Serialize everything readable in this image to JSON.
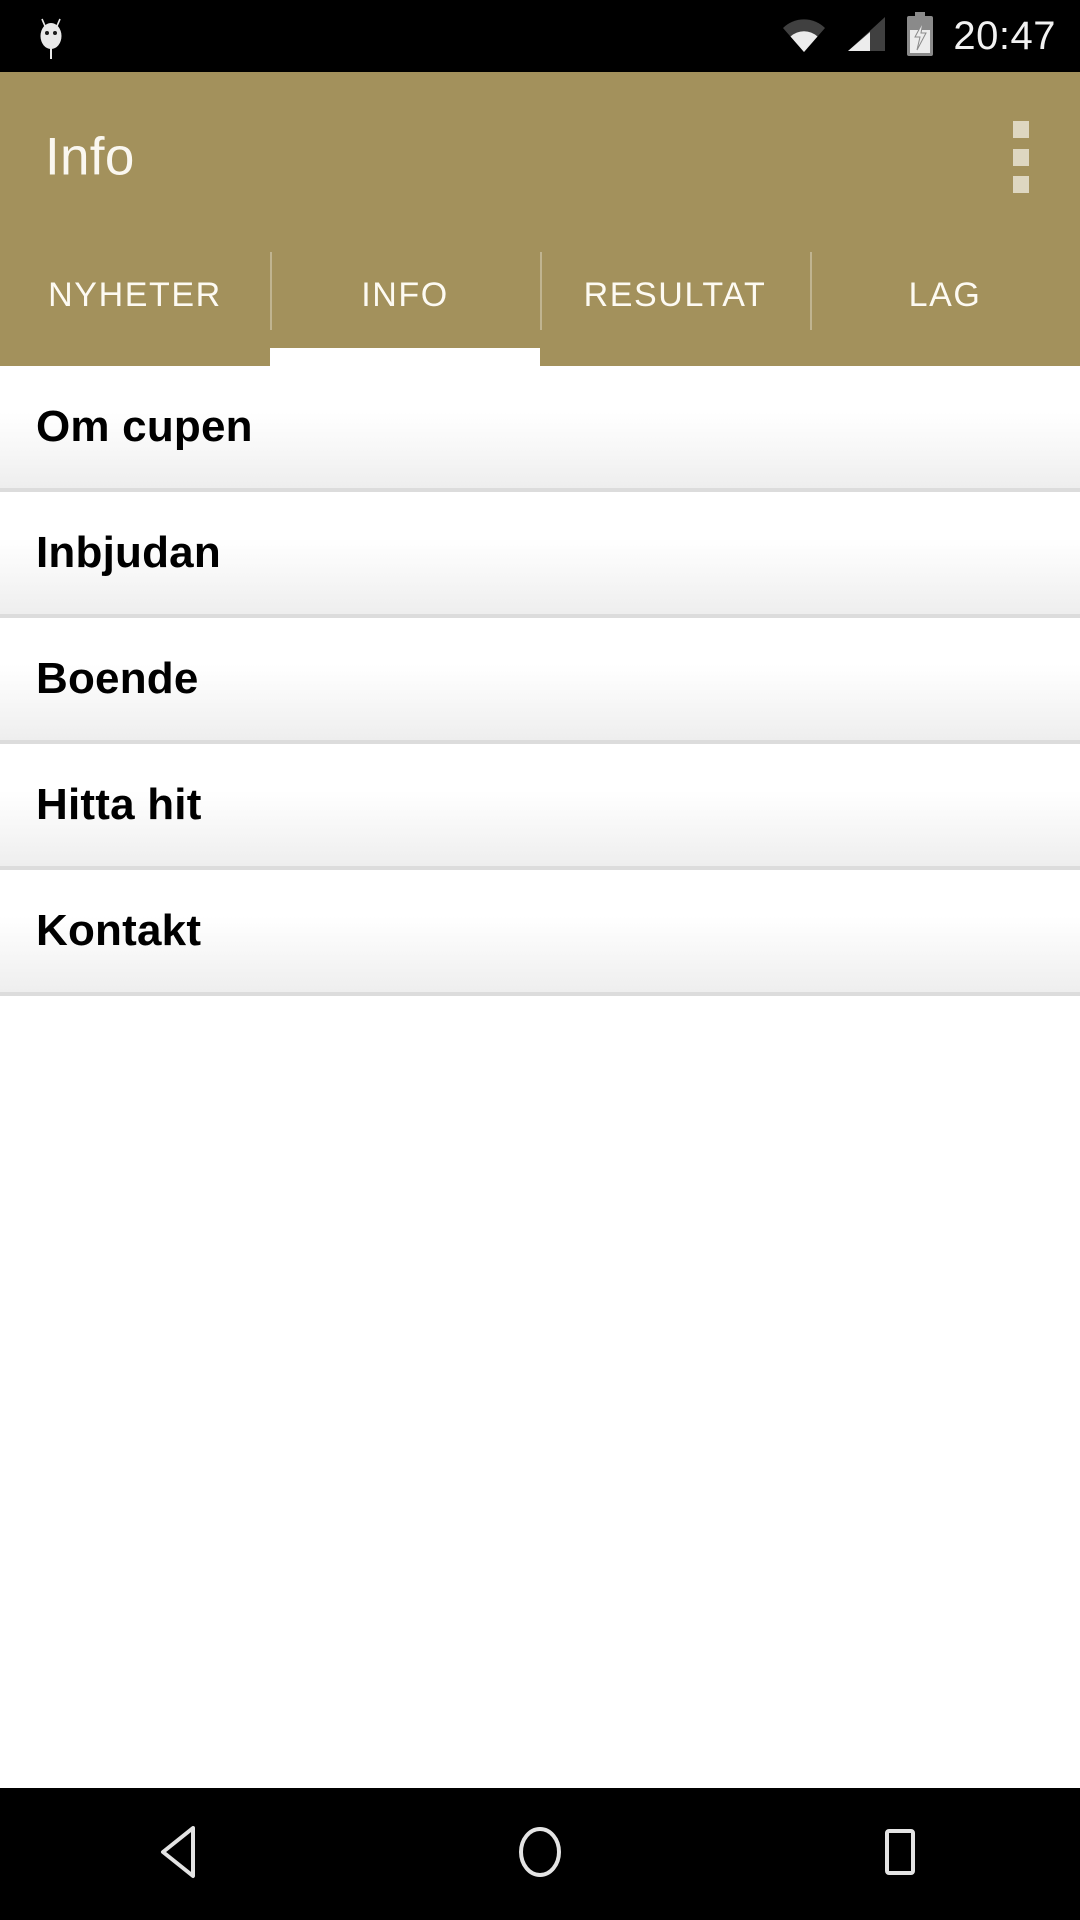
{
  "status_bar": {
    "android_icon": "android-head-icon",
    "wifi_icon": "wifi-icon",
    "signal_icon": "cellular-signal-icon",
    "battery_icon": "battery-charging-icon",
    "time": "20:47"
  },
  "app_bar": {
    "title": "Info",
    "overflow_icon": "overflow-menu-icon",
    "background_color": "#a3915c",
    "title_color": "#faf7f0"
  },
  "tabs": [
    {
      "label": "NYHETER",
      "active": false
    },
    {
      "label": "INFO",
      "active": true
    },
    {
      "label": "RESULTAT",
      "active": false
    },
    {
      "label": "LAG",
      "active": false
    }
  ],
  "list": {
    "items": [
      {
        "label": "Om cupen"
      },
      {
        "label": "Inbjudan"
      },
      {
        "label": "Boende"
      },
      {
        "label": "Hitta hit"
      },
      {
        "label": "Kontakt"
      }
    ]
  },
  "nav_bar": {
    "back": "back-triangle-icon",
    "home": "home-circle-icon",
    "recents": "recents-square-icon"
  }
}
